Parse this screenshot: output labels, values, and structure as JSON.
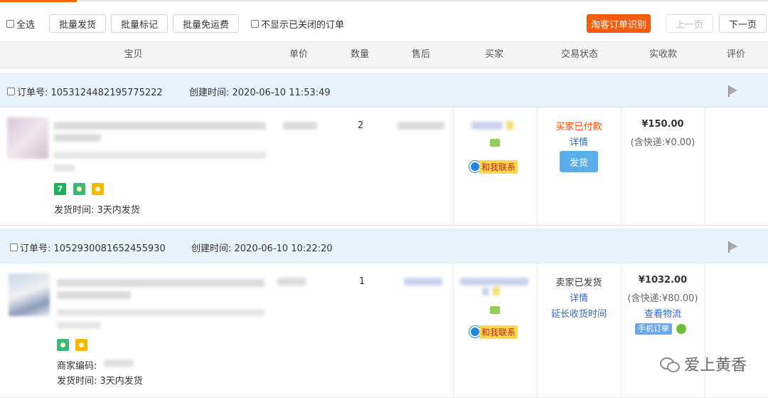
{
  "toolbar": {
    "select_all": "全选",
    "batch_ship": "批量发货",
    "batch_mark": "批量标记",
    "batch_free_shipping": "批量免运费",
    "hide_closed": "不显示已关闭的订单",
    "taoke_identify": "淘客订单识别",
    "prev_page": "上一页",
    "next_page": "下一页"
  },
  "columns": {
    "item": "宝贝",
    "unit_price": "单价",
    "quantity": "数量",
    "after_sale": "售后",
    "buyer": "买家",
    "status": "交易状态",
    "paid": "实收款",
    "review": "评价"
  },
  "orders": [
    {
      "order_no": "订单号: 1053124482195775222",
      "created": "创建时间: 2020-06-10 11:53:49",
      "quantity": "2",
      "ship_time": "发货时间:  3天内发货",
      "status": "买家已付款",
      "detail": "详情",
      "ship_button": "发货",
      "contact": "和我联系",
      "price": "¥150.00",
      "shipping": "(含快递:¥0.00)"
    },
    {
      "order_no": "订单号: 1052930081652455930",
      "created": "创建时间: 2020-06-10 10:22:20",
      "quantity": "1",
      "merchant_code": "商家编码:",
      "ship_time": "发货时间:  3天内发货",
      "status": "卖家已发货",
      "detail": "详情",
      "extend": "延长收货时间",
      "contact": "和我联系",
      "price": "¥1032.00",
      "shipping": "(含快递:¥80.00)",
      "logistics": "查看物流",
      "mobile_tag": "手机订单"
    }
  ],
  "watermark": "爱上黄香",
  "colors": {
    "accent": "#f45d0f",
    "header_bg": "#e8f3fb",
    "link": "#3366cc",
    "status_red": "#f40"
  }
}
